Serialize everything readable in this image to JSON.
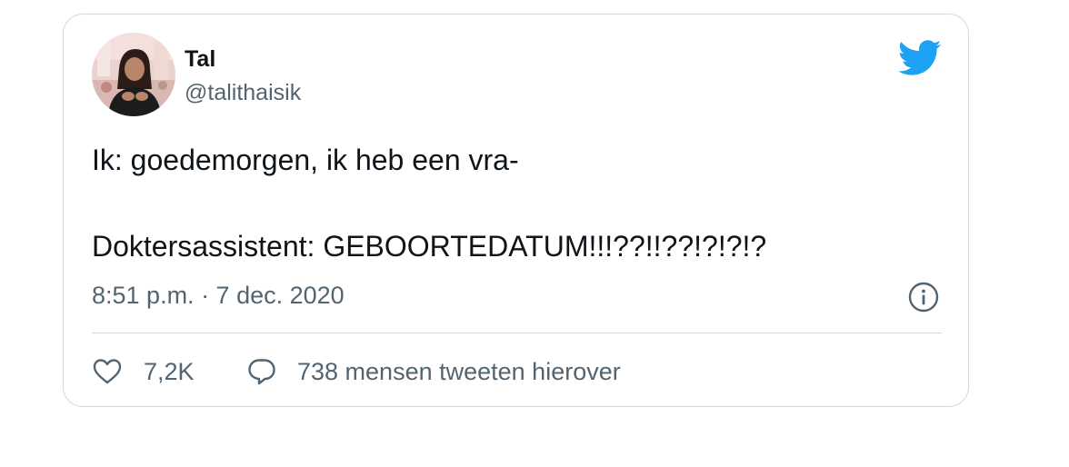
{
  "tweet": {
    "author": {
      "display_name": "Tal",
      "handle": "@talithaisik"
    },
    "text_lines": [
      "Ik: goedemorgen, ik heb een vra-",
      "Doktersassistent: GEBOORTEDATUM!!!??!!??!?!?!?"
    ],
    "timestamp": "8:51 p.m. · 7 dec. 2020",
    "likes_count": "7,2K",
    "conversation_label": "738 mensen tweeten hierover"
  },
  "icons": {
    "brand": "twitter-bird-icon",
    "info": "info-icon",
    "like": "heart-icon",
    "reply": "speech-bubble-icon"
  },
  "colors": {
    "brand_blue": "#1da1f2",
    "text_primary": "#0f1419",
    "text_secondary": "#536471",
    "border": "#cfd9de"
  }
}
